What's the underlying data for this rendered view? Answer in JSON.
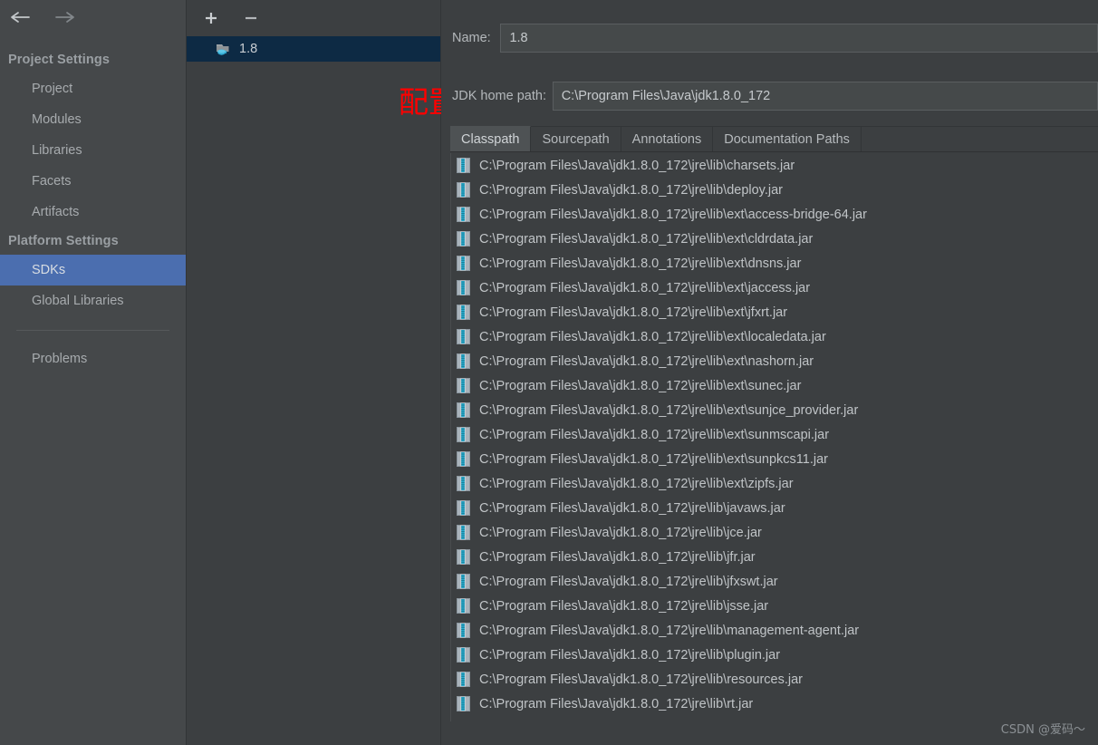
{
  "sidebar": {
    "nav": {
      "back_icon": "arrow-left-icon",
      "forward_icon": "arrow-right-icon"
    },
    "groups": [
      {
        "title": "Project Settings",
        "items": [
          {
            "label": "Project",
            "selected": false
          },
          {
            "label": "Modules",
            "selected": false
          },
          {
            "label": "Libraries",
            "selected": false
          },
          {
            "label": "Facets",
            "selected": false
          },
          {
            "label": "Artifacts",
            "selected": false
          }
        ]
      },
      {
        "title": "Platform Settings",
        "items": [
          {
            "label": "SDKs",
            "selected": true
          },
          {
            "label": "Global Libraries",
            "selected": false
          }
        ]
      }
    ],
    "footer_items": [
      {
        "label": "Problems",
        "selected": false
      }
    ]
  },
  "sdk_panel": {
    "toolbar": {
      "add_label": "+",
      "remove_label": "−"
    },
    "items": [
      {
        "label": "1.8",
        "icon": "jdk-folder-icon",
        "selected": true
      }
    ],
    "annotation": "配置jdk"
  },
  "detail": {
    "name_label": "Name:",
    "name_value": "1.8",
    "home_label": "JDK home path:",
    "home_value": "C:\\Program Files\\Java\\jdk1.8.0_172",
    "tabs": [
      {
        "label": "Classpath",
        "active": true
      },
      {
        "label": "Sourcepath",
        "active": false
      },
      {
        "label": "Annotations",
        "active": false
      },
      {
        "label": "Documentation Paths",
        "active": false
      }
    ],
    "classpath": [
      "C:\\Program Files\\Java\\jdk1.8.0_172\\jre\\lib\\charsets.jar",
      "C:\\Program Files\\Java\\jdk1.8.0_172\\jre\\lib\\deploy.jar",
      "C:\\Program Files\\Java\\jdk1.8.0_172\\jre\\lib\\ext\\access-bridge-64.jar",
      "C:\\Program Files\\Java\\jdk1.8.0_172\\jre\\lib\\ext\\cldrdata.jar",
      "C:\\Program Files\\Java\\jdk1.8.0_172\\jre\\lib\\ext\\dnsns.jar",
      "C:\\Program Files\\Java\\jdk1.8.0_172\\jre\\lib\\ext\\jaccess.jar",
      "C:\\Program Files\\Java\\jdk1.8.0_172\\jre\\lib\\ext\\jfxrt.jar",
      "C:\\Program Files\\Java\\jdk1.8.0_172\\jre\\lib\\ext\\localedata.jar",
      "C:\\Program Files\\Java\\jdk1.8.0_172\\jre\\lib\\ext\\nashorn.jar",
      "C:\\Program Files\\Java\\jdk1.8.0_172\\jre\\lib\\ext\\sunec.jar",
      "C:\\Program Files\\Java\\jdk1.8.0_172\\jre\\lib\\ext\\sunjce_provider.jar",
      "C:\\Program Files\\Java\\jdk1.8.0_172\\jre\\lib\\ext\\sunmscapi.jar",
      "C:\\Program Files\\Java\\jdk1.8.0_172\\jre\\lib\\ext\\sunpkcs11.jar",
      "C:\\Program Files\\Java\\jdk1.8.0_172\\jre\\lib\\ext\\zipfs.jar",
      "C:\\Program Files\\Java\\jdk1.8.0_172\\jre\\lib\\javaws.jar",
      "C:\\Program Files\\Java\\jdk1.8.0_172\\jre\\lib\\jce.jar",
      "C:\\Program Files\\Java\\jdk1.8.0_172\\jre\\lib\\jfr.jar",
      "C:\\Program Files\\Java\\jdk1.8.0_172\\jre\\lib\\jfxswt.jar",
      "C:\\Program Files\\Java\\jdk1.8.0_172\\jre\\lib\\jsse.jar",
      "C:\\Program Files\\Java\\jdk1.8.0_172\\jre\\lib\\management-agent.jar",
      "C:\\Program Files\\Java\\jdk1.8.0_172\\jre\\lib\\plugin.jar",
      "C:\\Program Files\\Java\\jdk1.8.0_172\\jre\\lib\\resources.jar",
      "C:\\Program Files\\Java\\jdk1.8.0_172\\jre\\lib\\rt.jar"
    ]
  },
  "watermark": "CSDN @爱码～",
  "colors": {
    "window_bg": "#3c3f41",
    "sidebar_bg": "#45484a",
    "selection_blue": "#4b6eaf",
    "sdk_selection": "#0d2a44",
    "annotation_red": "#ff0000",
    "text": "#c0c4c7",
    "input_bg": "#45494a",
    "tab_active_bg": "#4e5254"
  }
}
